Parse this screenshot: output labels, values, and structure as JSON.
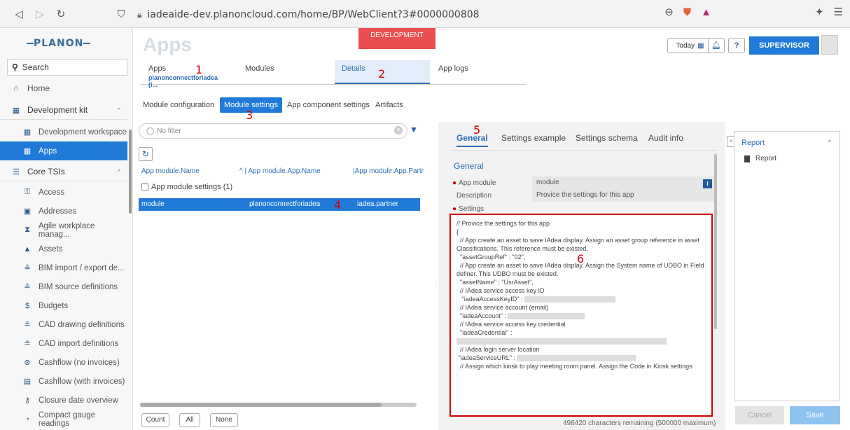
{
  "browser": {
    "url": "iadeaide-dev.planoncloud.com/home/BP/WebClient?3#0000000808"
  },
  "sidebar": {
    "logo": "PLANON",
    "search_label": "Search",
    "items": [
      {
        "label": "Home",
        "icon": "home-icon"
      },
      {
        "label": "Development kit",
        "icon": "dev-kit-icon"
      },
      {
        "label": "Development workspace",
        "icon": "workspace-icon"
      },
      {
        "label": "Apps",
        "icon": "apps-icon"
      },
      {
        "label": "Core TSIs",
        "icon": "list-icon"
      },
      {
        "label": "Access",
        "icon": "key-icon"
      },
      {
        "label": "Addresses",
        "icon": "address-icon"
      },
      {
        "label": "Agile workplace manag...",
        "icon": "agile-icon"
      },
      {
        "label": "Assets",
        "icon": "assets-icon"
      },
      {
        "label": "BIM import / export de...",
        "icon": "bim-icon"
      },
      {
        "label": "BIM source definitions",
        "icon": "bim-source-icon"
      },
      {
        "label": "Budgets",
        "icon": "budget-icon"
      },
      {
        "label": "CAD drawing definitions",
        "icon": "cad-icon"
      },
      {
        "label": "CAD import definitions",
        "icon": "cad-import-icon"
      },
      {
        "label": "Cashflow (no invoices)",
        "icon": "cashflow-icon"
      },
      {
        "label": "Cashflow (with invoices)",
        "icon": "invoice-icon"
      },
      {
        "label": "Closure date overview",
        "icon": "lock-icon"
      },
      {
        "label": "Compact gauge readings",
        "icon": "gauge-icon"
      }
    ]
  },
  "header": {
    "title": "Apps",
    "env_badge": "DEVELOPMENT",
    "today_label": "Today",
    "user_label": "SUPERVISOR"
  },
  "top_tabs": [
    {
      "label": "Apps",
      "sub": "planonconnectforiadea (i..."
    },
    {
      "label": "Modules",
      "sub": ""
    },
    {
      "label": "Details",
      "sub": ""
    },
    {
      "label": "App logs",
      "sub": ""
    }
  ],
  "sub_tabs": [
    "Module configuration",
    "Module settings",
    "App component settings",
    "Artifacts"
  ],
  "annotations": [
    "1",
    "2",
    "3",
    "4",
    "5",
    "6"
  ],
  "list": {
    "filter_placeholder": "No filter",
    "columns": [
      "App module.Name",
      "App module.App.Name",
      "App module.App.Partr"
    ],
    "group_label": "App module settings (1)",
    "row": {
      "name": "module",
      "app": "planonconnectforiadea",
      "partner": "iadea.partner"
    },
    "footer_buttons": [
      "Count",
      "All",
      "None"
    ]
  },
  "detail": {
    "tabs": [
      "General",
      "Settings example",
      "Settings schema",
      "Audit info"
    ],
    "section_title": "General",
    "fields": [
      {
        "label": "App module",
        "value": "module",
        "required": true
      },
      {
        "label": "Description",
        "value": "Provice the settings for this app",
        "required": false
      },
      {
        "label": "Settings",
        "value": "",
        "required": true
      }
    ],
    "settings_lines": [
      "// Provice the settings for this app",
      "{",
      "  // App create an asset to save IAdea display. Assign an asset group reference in asset Classifications. This reference must be existed.",
      "  \"assetGroupRef\" : \"02\",",
      "",
      "  // App create an asset to save IAdea display. Assign the System name of UDBO in Field definer. This UDBO must be existed.",
      "  \"assetName\" : \"UsrAsset\",",
      "",
      "  // IAdea service access key ID",
      "   \"iadeaAccessKeyID\" :",
      "",
      "  // IAdea service account (email)",
      "  \"iadeaAccount\" :",
      "",
      "  // IAdea service access key credential",
      "  \"iadeaCredential\" :",
      "",
      "",
      "  // IAdea login server location",
      " \"iadeaServiceURL\" :",
      "",
      "  // Assign which kiosk to play meeting room panel. Assign the Code in Kiosk settings"
    ],
    "chars_remaining": "498420 characters remaining (500000 maximum)"
  },
  "report": {
    "title": "Report",
    "item": "Report"
  },
  "actions": {
    "cancel": "Cancel",
    "save": "Save"
  },
  "colors": {
    "accent": "#1f7ad8",
    "badge": "#e94f4f",
    "annotation": "#d40000"
  }
}
